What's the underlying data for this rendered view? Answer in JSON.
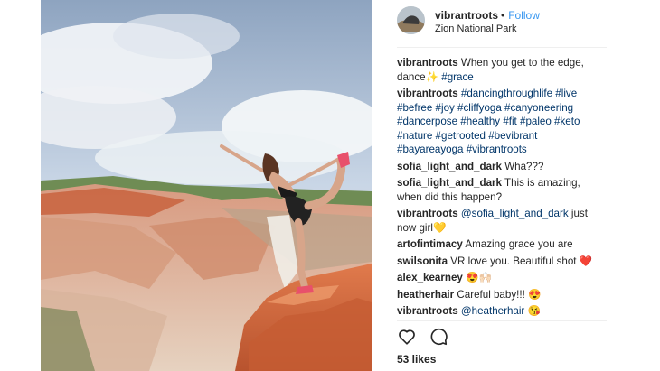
{
  "post": {
    "username": "vibrantroots",
    "separator": "•",
    "follow_label": "Follow",
    "location": "Zion National Park",
    "likes": "53 likes"
  },
  "comments": [
    {
      "user": "vibrantroots",
      "text": "When you get to the edge, dance✨ ",
      "tags": "#grace"
    },
    {
      "user": "vibrantroots",
      "text": "",
      "tags": "#dancingthroughlife #live #befree #joy #cliffyoga #canyoneering #dancerpose #healthy #fit #paleo #keto #nature #getrooted #bevibrant #bayareayoga #vibrantroots"
    },
    {
      "user": "sofia_light_and_dark",
      "text": "Wha???",
      "tags": ""
    },
    {
      "user": "sofia_light_and_dark",
      "text": "This is amazing, when did this happen?",
      "tags": ""
    },
    {
      "user": "vibrantroots",
      "text": "just now girl💛",
      "mention": "@sofia_light_and_dark"
    },
    {
      "user": "artofintimacy",
      "text": "Amazing grace you are",
      "tags": ""
    },
    {
      "user": "swilsonita",
      "text": "VR love you. Beautiful shot ❤️",
      "tags": ""
    },
    {
      "user": "alex_kearney",
      "text": "😍🙌🏻",
      "tags": ""
    },
    {
      "user": "heatherhair",
      "text": "Careful baby!!! 😍",
      "tags": ""
    },
    {
      "user": "vibrantroots",
      "text": "😘",
      "mention": "@heatherhair"
    }
  ],
  "icons": {
    "like": "heart-outline-icon",
    "comment": "speech-bubble-icon"
  },
  "colors": {
    "accent": "#3897f0",
    "hashtag": "#003569",
    "text": "#262626"
  }
}
